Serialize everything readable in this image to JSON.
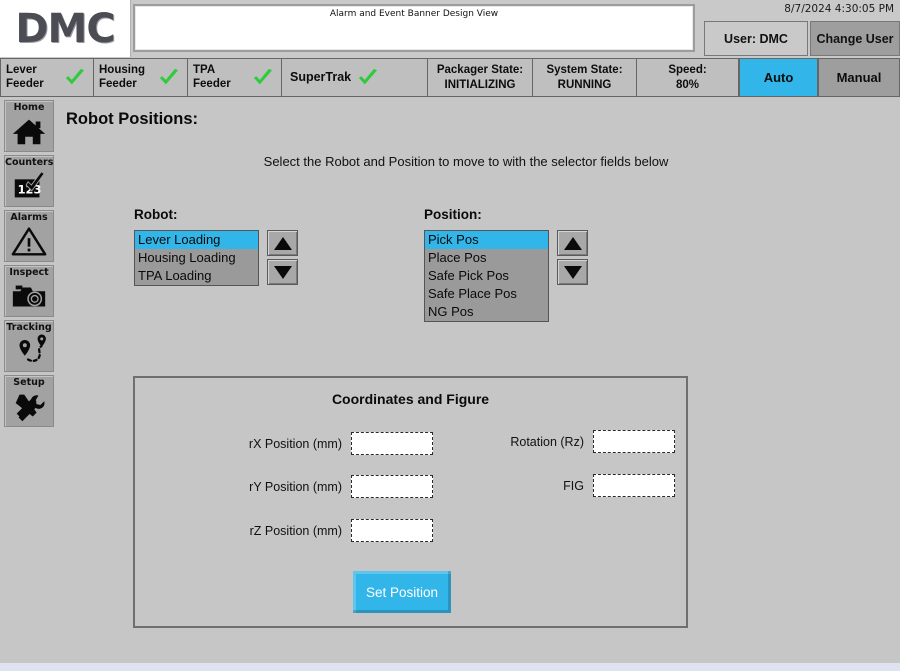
{
  "header": {
    "logo": "DMC",
    "alarm_banner_title": "Alarm and Event Banner Design View",
    "datetime": "8/7/2024 4:30:05 PM",
    "user_button": "User: DMC",
    "change_user_button": "Change User"
  },
  "statusbar": {
    "cells": [
      {
        "name": "lever-feeder",
        "label": "Lever\nFeeder",
        "status_icon": "green-check-icon"
      },
      {
        "name": "housing-feeder",
        "label": "Housing\nFeeder",
        "status_icon": "green-check-icon"
      },
      {
        "name": "tpa-feeder",
        "label": "TPA\nFeeder",
        "status_icon": "green-check-icon"
      },
      {
        "name": "supertrak",
        "label": "SuperTrak",
        "status_icon": "green-check-icon"
      }
    ],
    "packager_state": {
      "title": "Packager State:",
      "value": "INITIALIZING"
    },
    "system_state": {
      "title": "System State:",
      "value": "RUNNING"
    },
    "speed": {
      "title": "Speed:",
      "value": "80%"
    },
    "auto_button": "Auto",
    "manual_button": "Manual",
    "active_mode": "Auto"
  },
  "sidebar": {
    "items": [
      {
        "label": "Home",
        "icon": "house-icon"
      },
      {
        "label": "Counters",
        "icon": "counter-123-check-icon"
      },
      {
        "label": "Alarms",
        "icon": "warning-triangle-icon"
      },
      {
        "label": "Inspect",
        "icon": "camera-icon"
      },
      {
        "label": "Tracking",
        "icon": "map-pin-path-icon"
      },
      {
        "label": "Setup",
        "icon": "wrench-screwdriver-icon"
      }
    ]
  },
  "main": {
    "page_title": "Robot Positions:",
    "instruction": "Select the Robot and Position to move to with the selector fields below",
    "robot_selector": {
      "label": "Robot:",
      "options": [
        "Lever Loading",
        "Housing Loading",
        "TPA Loading"
      ],
      "selected": "Lever Loading"
    },
    "position_selector": {
      "label": "Position:",
      "options": [
        "Pick Pos",
        "Place Pos",
        "Safe Pick Pos",
        "Safe Place Pos",
        "NG Pos"
      ],
      "selected": "Pick Pos"
    },
    "coordinates_panel": {
      "title": "Coordinates and Figure",
      "fields": [
        {
          "label": "rX Position (mm)",
          "value": ""
        },
        {
          "label": "rY Position (mm)",
          "value": ""
        },
        {
          "label": "rZ Position (mm)",
          "value": ""
        },
        {
          "label": "Rotation (Rz)",
          "value": ""
        },
        {
          "label": "FIG",
          "value": ""
        }
      ],
      "set_position_button": "Set Position"
    }
  },
  "colors": {
    "accent_blue": "#32b5e8",
    "status_ok_green": "#2ecb3c",
    "panel_gray": "#c6c6c6",
    "listbox_gray": "#9a9a9a"
  }
}
